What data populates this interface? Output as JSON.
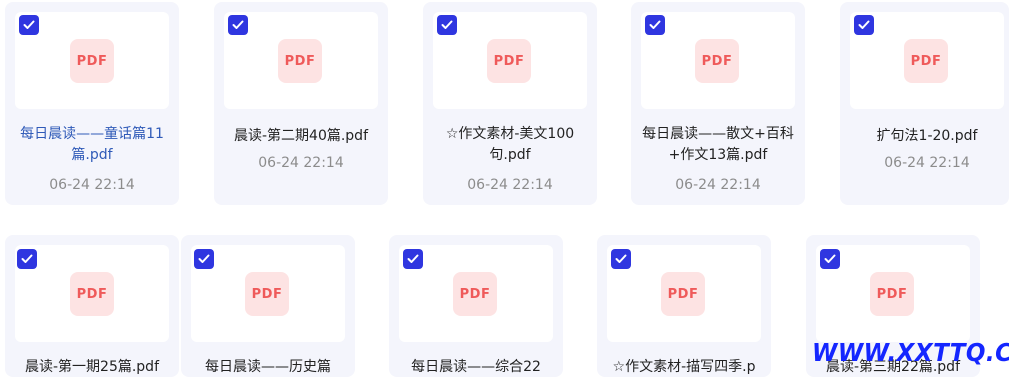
{
  "files": [
    {
      "name": "每日晨读——童话篇11篇.pdf",
      "date": "06-24 22:14",
      "icon_label": "PDF",
      "selected": true
    },
    {
      "name": "晨读-第二期40篇.pdf",
      "date": "06-24 22:14",
      "icon_label": "PDF",
      "selected": true
    },
    {
      "name": "☆作文素材-美文100句.pdf",
      "date": "06-24 22:14",
      "icon_label": "PDF",
      "selected": true
    },
    {
      "name": "每日晨读——散文+百科+作文13篇.pdf",
      "date": "06-24 22:14",
      "icon_label": "PDF",
      "selected": true
    },
    {
      "name": "扩句法1-20.pdf",
      "date": "06-24 22:14",
      "icon_label": "PDF",
      "selected": true
    },
    {
      "name": "晨读-第一期25篇.pdf",
      "icon_label": "PDF",
      "selected": true
    },
    {
      "name": "每日晨读——历史篇",
      "icon_label": "PDF",
      "selected": true
    },
    {
      "name": "每日晨读——综合22",
      "icon_label": "PDF",
      "selected": true
    },
    {
      "name": "☆作文素材-描写四季.p",
      "icon_label": "PDF",
      "selected": true
    },
    {
      "name": "晨读-第三期22篇.pdf",
      "icon_label": "PDF",
      "selected": true
    }
  ],
  "watermark": "WWW.XXTTQ.COM",
  "colors": {
    "checkbox": "#2f36e0",
    "pdf_icon_bg": "#fde3e3",
    "pdf_icon_text": "#ef5a5a",
    "card_bg": "#f4f5fc",
    "active_name": "#2f5ab8",
    "watermark": "#1426ff"
  }
}
